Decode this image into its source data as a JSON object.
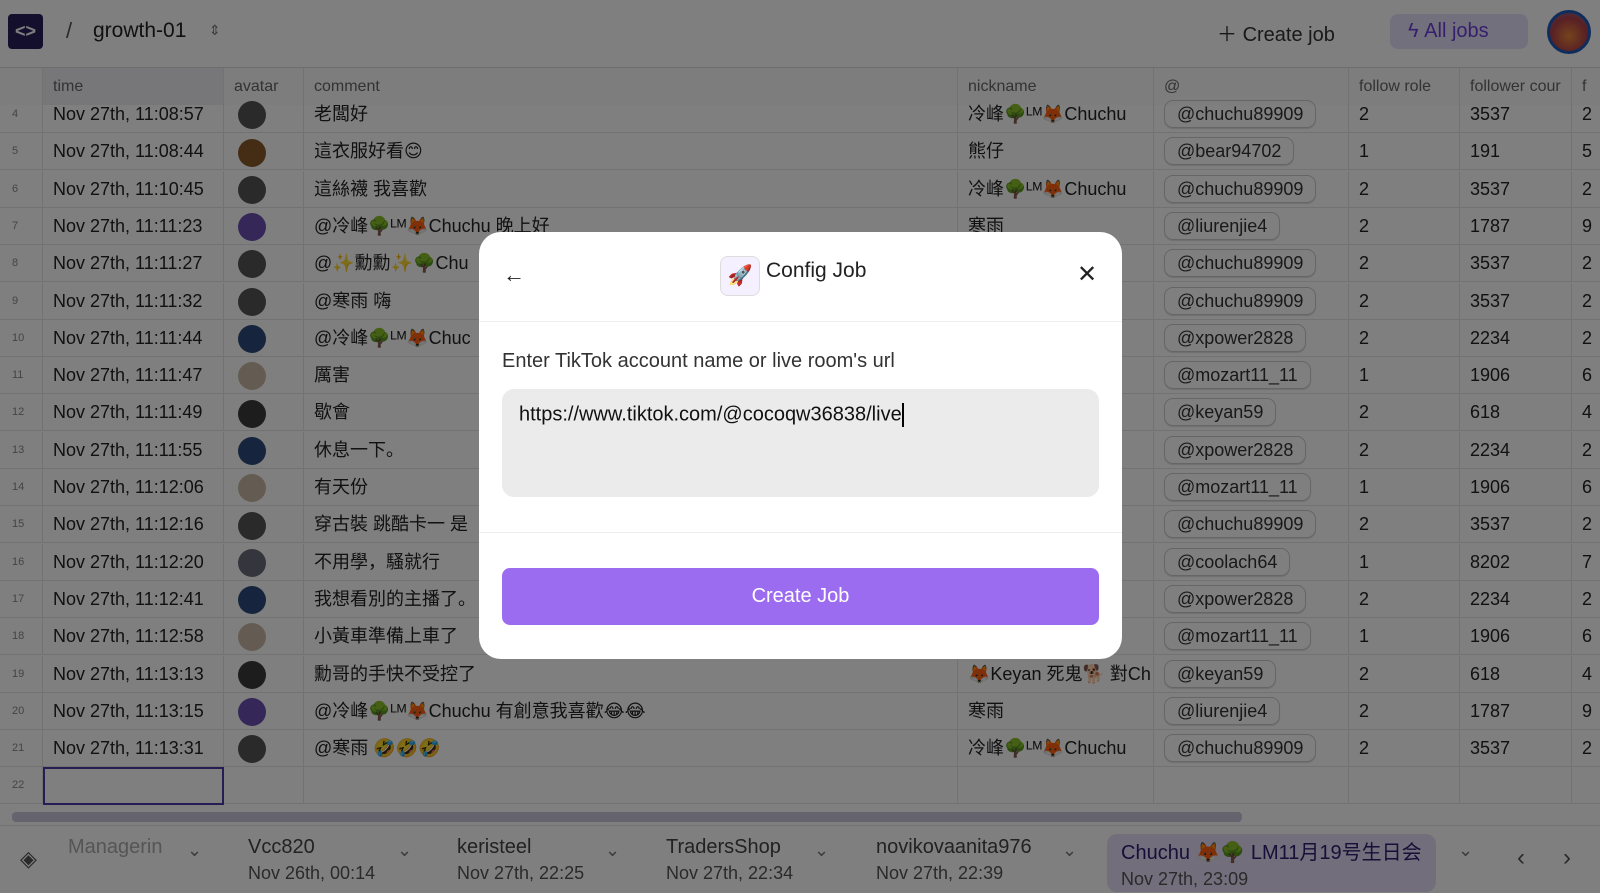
{
  "header": {
    "project": "growth-01",
    "create_job": "Create job",
    "all_jobs": "All jobs"
  },
  "columns": [
    "time",
    "avatar",
    "comment",
    "nickname",
    "@",
    "follow role",
    "follower cour",
    "f"
  ],
  "rows": [
    {
      "n": "4",
      "time": "Nov 27th, 11:08:57",
      "avatar": "#555",
      "comment": "老闆好",
      "nickname": "冷峰🌳ᴸᴹ🦊Chuchu",
      "handle": "@chuchu89909",
      "role": "2",
      "followers": "3537",
      "f": "2"
    },
    {
      "n": "5",
      "time": "Nov 27th, 11:08:44",
      "avatar": "#8a5a2a",
      "comment": "這衣服好看😊",
      "nickname": "熊仔",
      "handle": "@bear94702",
      "role": "1",
      "followers": "191",
      "f": "5"
    },
    {
      "n": "6",
      "time": "Nov 27th, 11:10:45",
      "avatar": "#555",
      "comment": "這絲襪 我喜歡",
      "nickname": "冷峰🌳ᴸᴹ🦊Chuchu",
      "handle": "@chuchu89909",
      "role": "2",
      "followers": "3537",
      "f": "2"
    },
    {
      "n": "7",
      "time": "Nov 27th, 11:11:23",
      "avatar": "#6b4fb0",
      "comment": "@冷峰🌳ᴸᴹ🦊Chuchu 晚上好",
      "nickname": "寒雨",
      "handle": "@liurenjie4",
      "role": "2",
      "followers": "1787",
      "f": "9"
    },
    {
      "n": "8",
      "time": "Nov 27th, 11:11:27",
      "avatar": "#555",
      "comment": "@✨勳勳✨🌳Chu",
      "nickname": "",
      "handle": "@chuchu89909",
      "role": "2",
      "followers": "3537",
      "f": "2"
    },
    {
      "n": "9",
      "time": "Nov 27th, 11:11:32",
      "avatar": "#555",
      "comment": "@寒雨 嗨",
      "nickname": "",
      "handle": "@chuchu89909",
      "role": "2",
      "followers": "3537",
      "f": "2"
    },
    {
      "n": "10",
      "time": "Nov 27th, 11:11:44",
      "avatar": "#2c4a7a",
      "comment": "@冷峰🌳ᴸᴹ🦊Chuc",
      "nickname": "",
      "handle": "@xpower2828",
      "role": "2",
      "followers": "2234",
      "f": "2"
    },
    {
      "n": "11",
      "time": "Nov 27th, 11:11:47",
      "avatar": "#c9b9a5",
      "comment": "厲害",
      "nickname": "",
      "handle": "@mozart11_11",
      "role": "1",
      "followers": "1906",
      "f": "6"
    },
    {
      "n": "12",
      "time": "Nov 27th, 11:11:49",
      "avatar": "#3a3a3a",
      "comment": "歇會",
      "nickname": "",
      "handle": "@keyan59",
      "role": "2",
      "followers": "618",
      "f": "4"
    },
    {
      "n": "13",
      "time": "Nov 27th, 11:11:55",
      "avatar": "#2c4a7a",
      "comment": "休息一下。",
      "nickname": "",
      "handle": "@xpower2828",
      "role": "2",
      "followers": "2234",
      "f": "2"
    },
    {
      "n": "14",
      "time": "Nov 27th, 11:12:06",
      "avatar": "#c9b9a5",
      "comment": "有天份",
      "nickname": "",
      "handle": "@mozart11_11",
      "role": "1",
      "followers": "1906",
      "f": "6"
    },
    {
      "n": "15",
      "time": "Nov 27th, 11:12:16",
      "avatar": "#555",
      "comment": "穿古裝 跳酷卡一 是",
      "nickname": "",
      "handle": "@chuchu89909",
      "role": "2",
      "followers": "3537",
      "f": "2"
    },
    {
      "n": "16",
      "time": "Nov 27th, 11:12:20",
      "avatar": "#6a6a7a",
      "comment": "不用學，騷就行",
      "nickname": "",
      "handle": "@coolach64",
      "role": "1",
      "followers": "8202",
      "f": "7"
    },
    {
      "n": "17",
      "time": "Nov 27th, 11:12:41",
      "avatar": "#2c4a7a",
      "comment": "我想看別的主播了。",
      "nickname": "",
      "handle": "@xpower2828",
      "role": "2",
      "followers": "2234",
      "f": "2"
    },
    {
      "n": "18",
      "time": "Nov 27th, 11:12:58",
      "avatar": "#c9b9a5",
      "comment": "小黃車準備上車了",
      "nickname": "",
      "handle": "@mozart11_11",
      "role": "1",
      "followers": "1906",
      "f": "6"
    },
    {
      "n": "19",
      "time": "Nov 27th, 11:13:13",
      "avatar": "#3a3a3a",
      "comment": "勳哥的手快不受控了",
      "nickname": "🦊Keyan 死鬼🐕 對Ch",
      "handle": "@keyan59",
      "role": "2",
      "followers": "618",
      "f": "4"
    },
    {
      "n": "20",
      "time": "Nov 27th, 11:13:15",
      "avatar": "#6b4fb0",
      "comment": "@冷峰🌳ᴸᴹ🦊Chuchu 有創意我喜歡😂😂",
      "nickname": "寒雨",
      "handle": "@liurenjie4",
      "role": "2",
      "followers": "1787",
      "f": "9"
    },
    {
      "n": "21",
      "time": "Nov 27th, 11:13:31",
      "avatar": "#555",
      "comment": "@寒雨 🤣🤣🤣",
      "nickname": "冷峰🌳ᴸᴹ🦊Chuchu",
      "handle": "@chuchu89909",
      "role": "2",
      "followers": "3537",
      "f": "2"
    },
    {
      "n": "22",
      "time": "",
      "avatar": "",
      "comment": "",
      "nickname": "",
      "handle": "",
      "role": "",
      "followers": "",
      "f": ""
    }
  ],
  "tabs": [
    {
      "name": "Managerin",
      "date": ""
    },
    {
      "name": "Vcc820",
      "date": "Nov 26th, 00:14"
    },
    {
      "name": "keristeel",
      "date": "Nov 27th, 22:25"
    },
    {
      "name": "TradersShop",
      "date": "Nov 27th, 22:34"
    },
    {
      "name": "novikovaanita976",
      "date": "Nov 27th, 22:39"
    },
    {
      "name": "Chuchu 🦊🌳 LM11月19号生日会",
      "date": "Nov 27th, 23:09"
    }
  ],
  "modal": {
    "title": "Config Job",
    "label": "Enter TikTok account name or live room's url",
    "value": "https://www.tiktok.com/@cocoqw36838/live",
    "submit": "Create Job"
  },
  "colors": {
    "accent": "#9b6cf0",
    "logo": "#2b1f5c"
  }
}
